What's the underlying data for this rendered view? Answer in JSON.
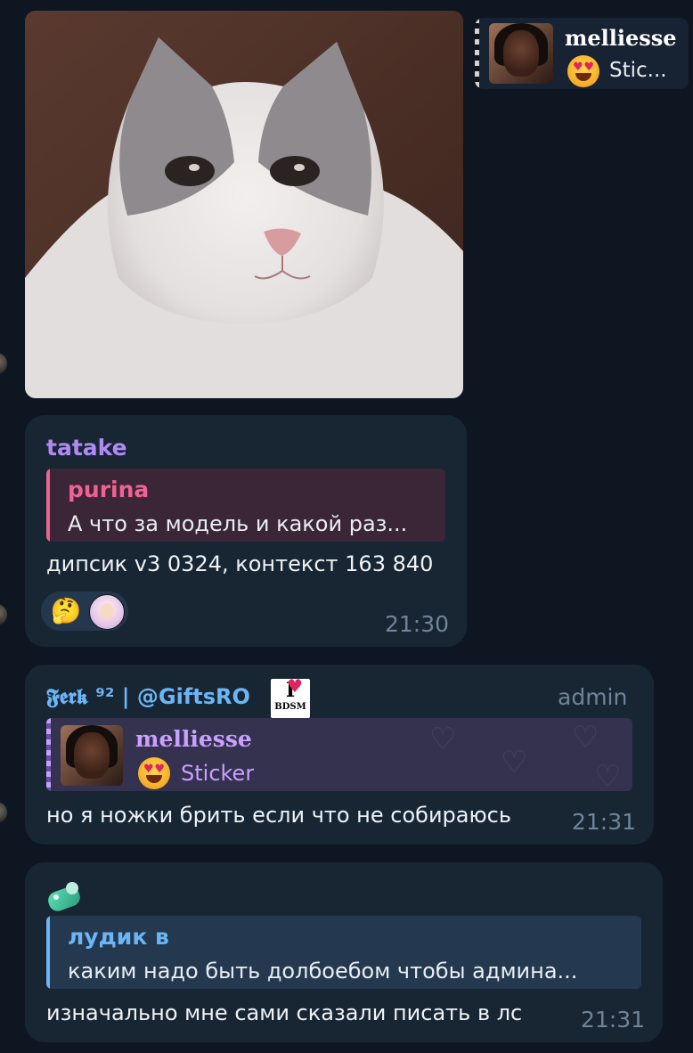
{
  "top_reply": {
    "name": "melliesse",
    "text": "Stic..."
  },
  "messages": [
    {
      "sender": "tatake",
      "reply": {
        "name": "purina",
        "text": "А что за модель и какой раз..."
      },
      "text": "дипсик v3 0324, контекст 163 840",
      "reactions": [
        "🤔",
        "avatar"
      ],
      "time": "21:30"
    },
    {
      "sender": "𝕱𝖊𝖗𝖐 ⁹² | @GiftsRO",
      "sender_badge": {
        "top": "I",
        "bottom": "BDSM"
      },
      "role": "admin",
      "reply": {
        "name": "melliesse",
        "text": "Sticker"
      },
      "text": "но я ножки брить если что не собираюсь",
      "time": "21:31"
    },
    {
      "sender_icon": "teal-gem-icon",
      "reply": {
        "name": "лудик в",
        "text": "каким надо быть долбоебом чтобы админа..."
      },
      "text": "изначально мне сами сказали писать в лс",
      "time": "21:31"
    }
  ],
  "colors": {
    "background": "#0e1621",
    "bubble": "#182533",
    "time": "#708499",
    "tatake": "#b089f5",
    "purina": "#f06292",
    "ferk": "#6cb5f5",
    "melliesse": "#c9a0ff",
    "ludik": "#6cb5f5"
  }
}
